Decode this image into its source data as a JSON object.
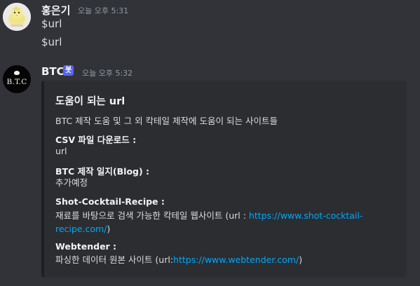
{
  "messages": [
    {
      "author": "홍은기",
      "timestamp": "오늘 오후 5:31",
      "lines": [
        "$url",
        "$url"
      ]
    },
    {
      "author": "BTC",
      "bot_badge": "봇",
      "avatar_text": "B.T.C",
      "timestamp": "오늘 오후 5:32",
      "embed": {
        "title": "도움이 되는 url",
        "description": "BTC 제작 도움 및 그 외 칵테일 제작에 도움이 되는 사이트들",
        "fields": [
          {
            "name": "CSV 파일 다운로드 :",
            "value": "url"
          },
          {
            "name": "BTC 제작 일지(Blog) :",
            "value": "추가예정"
          },
          {
            "name": "Shot-Cocktail-Recipe :",
            "value_prefix": "재료를 바탕으로 검색 가능한 칵테일 웹사이트 (url : ",
            "link": "https://www.shot-cocktail-recipe.com/",
            "value_suffix": ")"
          },
          {
            "name": "Webtender :",
            "value_prefix": "파싱한 데이터 원본 사이트 (url:",
            "link": "https://www.webtender.com/",
            "value_suffix": ")"
          }
        ]
      }
    }
  ],
  "colors": {
    "background": "#313338",
    "embed_background": "#2b2d31",
    "embed_border": "#1e1f22",
    "bot_badge": "#5865f2",
    "link": "#00a8fc"
  },
  "icons": {
    "user_avatar": "chick-avatar-icon",
    "bot_avatar": "btc-logo-icon"
  }
}
